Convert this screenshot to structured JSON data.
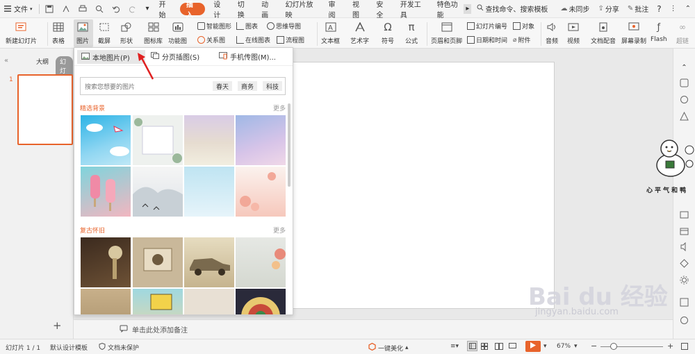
{
  "menubar": {
    "file": "文件",
    "tabs": [
      "开始",
      "插入",
      "设计",
      "切换",
      "动画",
      "幻灯片放映",
      "审阅",
      "视图",
      "安全",
      "开发工具",
      "特色功能"
    ],
    "active_tab": "插入",
    "search": "查找命令、搜索模板",
    "sync": "未同步",
    "share": "分享",
    "comment": "批注"
  },
  "ribbon": {
    "new_slide": "新建幻灯片",
    "table": "表格",
    "picture": "图片",
    "screenshot": "截屏",
    "shape": "形状",
    "icon_lib": "图标库",
    "function_chart": "功能图",
    "smart_art": "智能图形",
    "chart": "图表",
    "mind_map": "思维导图",
    "relation": "关系图",
    "online_chart": "在线图表",
    "flowchart": "流程图",
    "textbox": "文本框",
    "art_text": "艺术字",
    "symbol": "符号",
    "formula": "公式",
    "header_footer": "页眉和页脚",
    "slide_number": "幻灯片编号",
    "object": "对象",
    "datetime": "日期和时间",
    "attachment": "附件",
    "audio": "音频",
    "video": "视频",
    "doc_audio": "文档配音",
    "screen_record": "屏幕录制",
    "flash": "Flash",
    "hyperlink": "超链"
  },
  "leftpanel": {
    "outline": "大纲",
    "slides": "幻灯片",
    "slide_num": "1"
  },
  "dropdown": {
    "local_picture": "本地图片(P)",
    "paged_picture": "分页插图(S)",
    "phone_picture": "手机传图(M)...",
    "search_placeholder": "搜索您想要的图片",
    "chips": [
      "春天",
      "商务",
      "科技"
    ],
    "section1": "精选背景",
    "section2": "复古怀旧",
    "more": "更多"
  },
  "notes": {
    "placeholder": "单击此处添加备注"
  },
  "statusbar": {
    "slide_info": "幻灯片 1 / 1",
    "template": "默认设计模板",
    "protect": "文档未保护",
    "beautify": "一键美化",
    "zoom": "67%"
  },
  "watermark": {
    "brand": "Bai du 经验",
    "url": "jingyan.baidu.com",
    "duck_caption": "心平气和鸭"
  },
  "colors": {
    "accent": "#e8632b",
    "ribbon_bg": "#f7f7f7",
    "canvas_bg": "#e9e9e9"
  }
}
